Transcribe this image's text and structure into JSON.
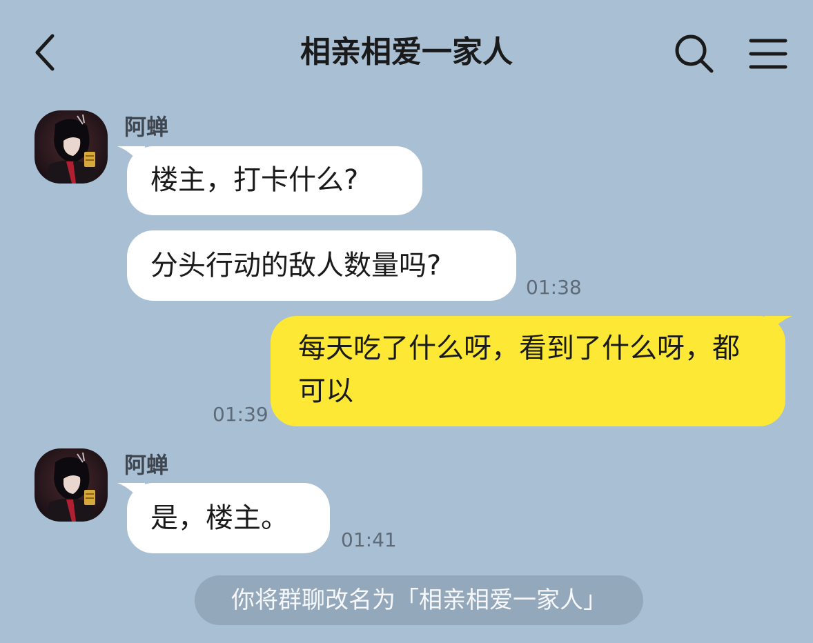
{
  "header": {
    "title": "相亲相爱一家人",
    "back_icon": "chevron-left-icon",
    "search_icon": "search-icon",
    "menu_icon": "menu-icon"
  },
  "messages": [
    {
      "sender": "阿蝉",
      "text": "楼主，打卡什么?",
      "direction": "incoming"
    },
    {
      "text": "分头行动的敌人数量吗?",
      "time": "01:38",
      "direction": "incoming"
    },
    {
      "text": "每天吃了什么呀，看到了什么呀，都可以",
      "time": "01:39",
      "direction": "outgoing"
    },
    {
      "sender": "阿蝉",
      "text": "是，楼主。",
      "time": "01:41",
      "direction": "incoming"
    }
  ],
  "system_notice": "你将群聊改名为「相亲相爱一家人」",
  "colors": {
    "background": "#a9bfd3",
    "incoming_bubble": "#ffffff",
    "outgoing_bubble": "#fde935",
    "system_pill": "#94a8bb"
  }
}
